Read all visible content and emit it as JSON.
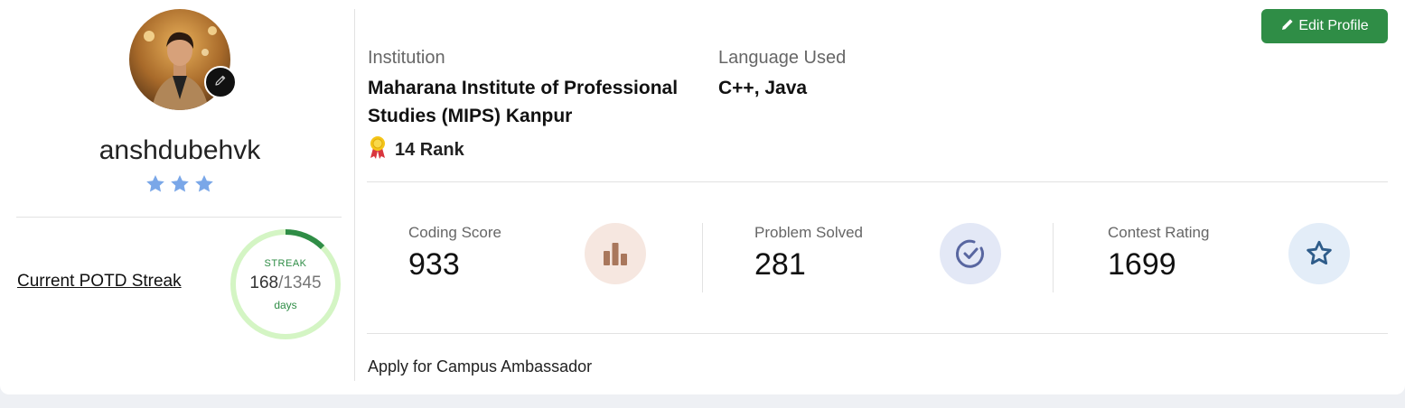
{
  "profile": {
    "username": "anshdubehvk",
    "star_count": 3,
    "avatar": "profile-photo"
  },
  "potd": {
    "label": "Current POTD Streak",
    "streak_label": "STREAK",
    "current": "168",
    "total": "/1345",
    "unit": "days",
    "progress_fraction": 0.125
  },
  "header": {
    "edit_label": "Edit Profile"
  },
  "info": {
    "institution_label": "Institution",
    "institution_line1": "Maharana Institute of Professional",
    "institution_line2": "Studies (MIPS) Kanpur",
    "rank": "14 Rank",
    "language_label": "Language Used",
    "language_value": "C++, Java"
  },
  "stats": [
    {
      "label": "Coding Score",
      "value": "933",
      "icon": "bar-chart-icon"
    },
    {
      "label": "Problem Solved",
      "value": "281",
      "icon": "check-circle-icon"
    },
    {
      "label": "Contest Rating",
      "value": "1699",
      "icon": "star-icon"
    }
  ],
  "campus": {
    "link": "Apply for Campus Ambassador"
  },
  "colors": {
    "accent": "#2f8d46",
    "streak_ring": "#d4f5c4",
    "star": "#7aa7e8"
  }
}
